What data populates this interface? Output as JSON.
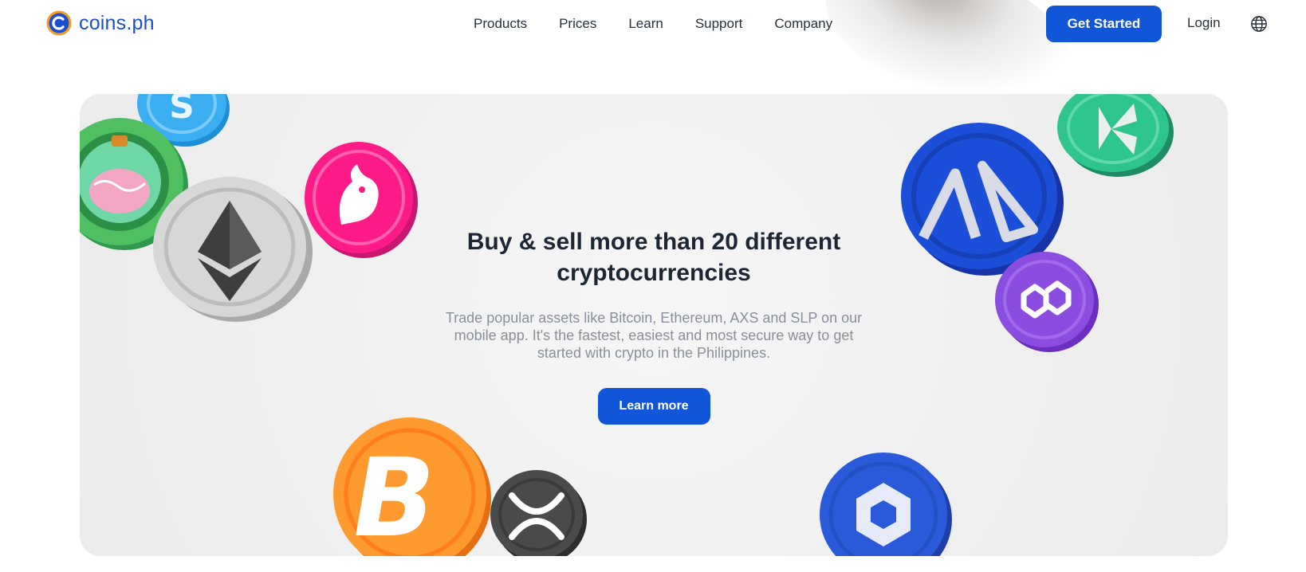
{
  "brand": {
    "name": "coins.ph",
    "color": "#1a4fd0",
    "logo_icon": "coins-ph-logo-icon"
  },
  "nav": {
    "items": [
      {
        "label": "Products"
      },
      {
        "label": "Prices"
      },
      {
        "label": "Learn"
      },
      {
        "label": "Support"
      },
      {
        "label": "Company"
      }
    ]
  },
  "header": {
    "cta_label": "Get Started",
    "login_label": "Login",
    "language_icon": "globe-icon"
  },
  "hero": {
    "title": "Buy & sell more than 20 different cryptocurrencies",
    "description": "Trade popular assets like Bitcoin, Ethereum, AXS and SLP on our mobile app. It's the fastest, easiest and most secure way to get started with crypto in the Philippines.",
    "cta_label": "Learn more",
    "coins": [
      "smooth-love-potion-coin",
      "ethereum-coin",
      "uniswap-coin",
      "sandbox-coin",
      "bitcoin-coin",
      "xrp-coin",
      "axie-infinity-coin",
      "kyber-coin",
      "polygon-coin",
      "chainlink-coin"
    ]
  },
  "colors": {
    "accent": "#1155d9",
    "card_bg": "#f1f1f1",
    "text_muted": "#8a8f98"
  }
}
